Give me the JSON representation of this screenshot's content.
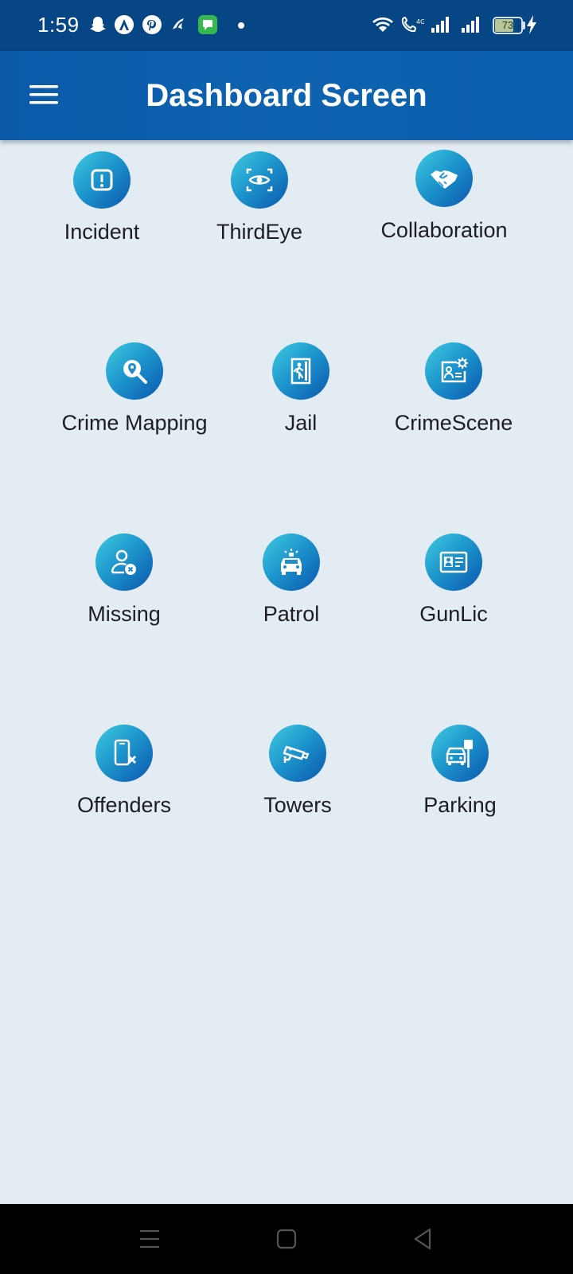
{
  "status_bar": {
    "time": "1:59",
    "battery": "73",
    "battery_level": 0.73,
    "notification_icons": [
      "snapchat-icon",
      "app-a-icon",
      "pinterest-icon",
      "app-swirl-icon",
      "messages-icon"
    ],
    "system_icons": [
      "wifi-icon",
      "volte-call-icon",
      "signal-sim1-icon",
      "signal-sim2-icon",
      "battery-icon",
      "charging-icon"
    ]
  },
  "app_bar": {
    "title": "Dashboard Screen",
    "menu_icon": "hamburger-menu-icon"
  },
  "tiles": [
    {
      "label": "Incident",
      "icon": "exclamation-icon"
    },
    {
      "label": "ThirdEye",
      "icon": "eye-scan-icon"
    },
    {
      "label": "Collaboration",
      "icon": "handshake-icon"
    },
    {
      "label": "Crime Mapping",
      "icon": "map-search-icon"
    },
    {
      "label": "Jail",
      "icon": "jail-door-icon"
    },
    {
      "label": "CrimeScene",
      "icon": "crime-scene-icon"
    },
    {
      "label": "Missing",
      "icon": "missing-person-icon"
    },
    {
      "label": "Patrol",
      "icon": "patrol-car-icon"
    },
    {
      "label": "GunLic",
      "icon": "license-card-icon"
    },
    {
      "label": "Offenders",
      "icon": "phone-cancel-icon"
    },
    {
      "label": "Towers",
      "icon": "cctv-camera-icon"
    },
    {
      "label": "Parking",
      "icon": "parking-icon"
    }
  ],
  "nav_bar": {
    "buttons": [
      "recents-icon",
      "home-icon",
      "back-icon"
    ]
  },
  "colors": {
    "status_bar": "#074685",
    "app_bar": "#0a5aa8",
    "background": "#e3ebf3",
    "icon_gradient_start": "#40cbe0",
    "icon_gradient_end": "#0b56ae"
  }
}
